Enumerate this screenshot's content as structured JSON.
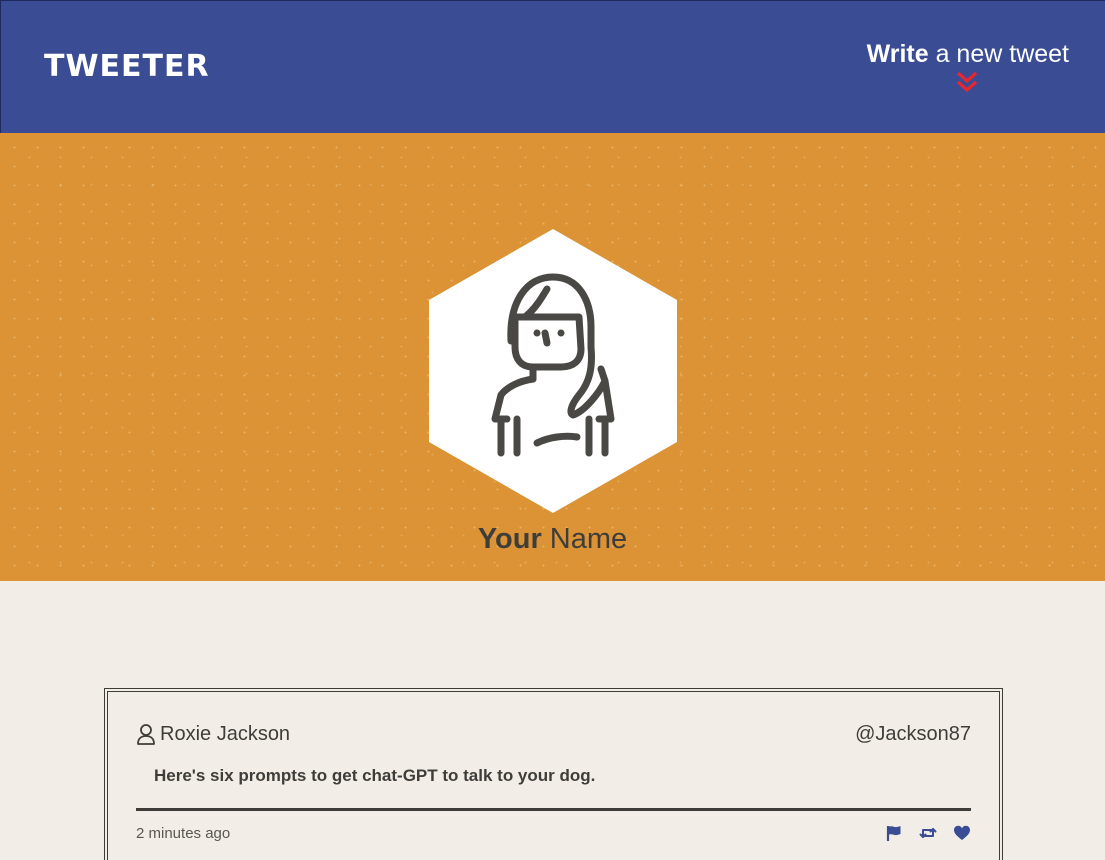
{
  "nav": {
    "brand": "TWEETER",
    "compose_bold": "Write",
    "compose_rest": " a new tweet",
    "compose_icon": "double-chevron-down-icon",
    "compose_icon_color": "#e8262f",
    "background_color": "#3a4d94"
  },
  "profile": {
    "name_bold": "Your",
    "name_rest": " Name",
    "avatar": "person-avatar-icon",
    "background_color": "#db9336"
  },
  "tweets": [
    {
      "author": "Roxie Jackson",
      "handle": "@Jackson87",
      "text": "Here's six prompts to get chat-GPT to talk to your dog.",
      "time": "2 minutes ago",
      "actions": [
        "flag-icon",
        "retweet-icon",
        "heart-icon"
      ]
    }
  ],
  "colors": {
    "page_background": "#f2eee7",
    "text": "#3f3d3a",
    "action_icons": "#3a4d94"
  }
}
